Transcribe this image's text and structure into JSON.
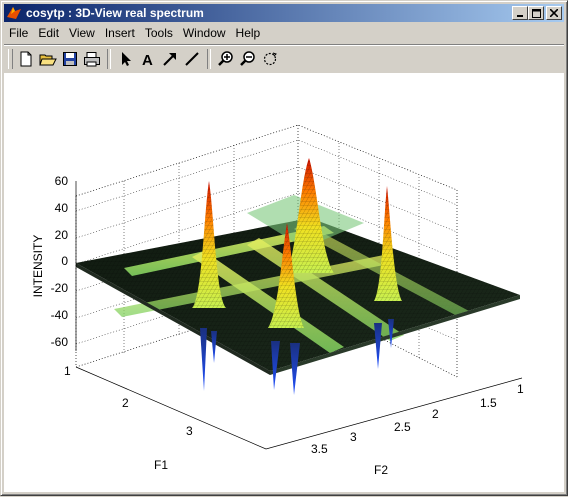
{
  "window": {
    "title": "cosytp : 3D-View real spectrum",
    "controls": [
      "minimize",
      "maximize",
      "close"
    ]
  },
  "menubar": {
    "items": [
      "File",
      "Edit",
      "View",
      "Insert",
      "Tools",
      "Window",
      "Help"
    ]
  },
  "toolbar": {
    "tools": [
      {
        "name": "new-figure-icon",
        "group": 1
      },
      {
        "name": "open-file-icon",
        "group": 1
      },
      {
        "name": "save-icon",
        "group": 1
      },
      {
        "name": "print-icon",
        "group": 1
      },
      {
        "name": "edit-plot-arrow-icon",
        "group": 2
      },
      {
        "name": "insert-text-icon",
        "group": 2,
        "glyph": "A"
      },
      {
        "name": "insert-arrow-icon",
        "group": 2
      },
      {
        "name": "insert-line-icon",
        "group": 2
      },
      {
        "name": "zoom-in-icon",
        "group": 3
      },
      {
        "name": "zoom-out-icon",
        "group": 3
      },
      {
        "name": "rotate-3d-icon",
        "group": 3
      }
    ]
  },
  "plot": {
    "type": "3d-surface",
    "zlabel": "INTENSITY",
    "xlabel": "F1",
    "ylabel": "F2",
    "z_ticks": [
      "60",
      "40",
      "20",
      "0",
      "-20",
      "-40",
      "-60"
    ],
    "f1_ticks": [
      "1",
      "2",
      "3"
    ],
    "f2_ticks": [
      "1",
      "1.5",
      "2",
      "2.5",
      "3",
      "3.5"
    ],
    "colormap": "jet",
    "colors": {
      "background": "#ffffff",
      "surface_low": "#1a1a1a",
      "peak_high": "#ff2000",
      "mid": "#c8f050"
    }
  }
}
